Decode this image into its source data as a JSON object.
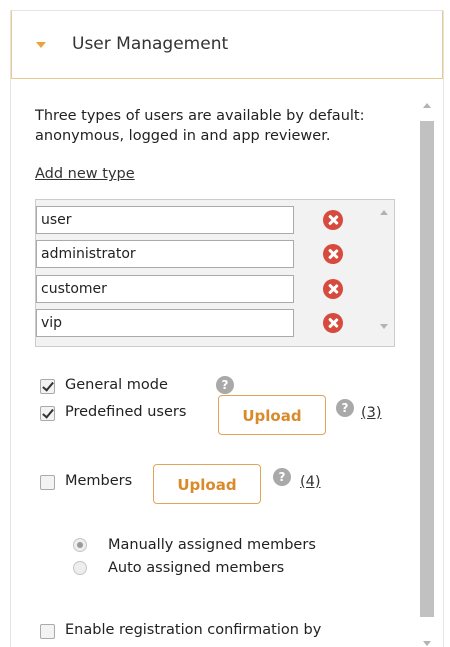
{
  "section": {
    "title": "User Management"
  },
  "description": "Three types of users are available by default: anonymous, logged in and app reviewer.",
  "add_type_label": "Add new type",
  "user_types": [
    "user",
    "administrator",
    "customer",
    "vip"
  ],
  "options": {
    "general_mode": {
      "label": "General mode",
      "checked": true
    },
    "predefined_users": {
      "label": "Predefined users",
      "checked": true,
      "upload_label": "Upload",
      "count": "(3)"
    },
    "members": {
      "label": "Members",
      "checked": false,
      "upload_label": "Upload",
      "count": "(4)"
    },
    "registration": {
      "label": "Enable registration confirmation by",
      "checked": false
    }
  },
  "member_assignment": {
    "options": [
      "Manually assigned members",
      "Auto assigned members"
    ],
    "selected": "Manually assigned members"
  },
  "icons": {
    "help": "?"
  },
  "colors": {
    "accent": "#e8a33d",
    "upload_text": "#d98a2b",
    "delete": "#d64b3d",
    "header_border": "#e8c98a"
  }
}
